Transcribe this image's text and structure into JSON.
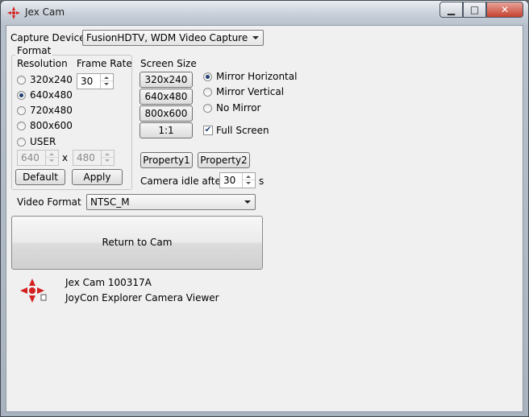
{
  "window": {
    "title": "Jex Cam",
    "controls": {
      "minimize": "▁",
      "maximize": "□",
      "close": "✕"
    }
  },
  "capture": {
    "label": "Capture Device",
    "device": "FusionHDTV, WDM Video Capture"
  },
  "format": {
    "group_title": "Format",
    "resolution_label": "Resolution",
    "frame_rate_label": "Frame Rate",
    "frame_rate_value": "30",
    "resolutions": [
      {
        "label": "320x240",
        "selected": false
      },
      {
        "label": "640x480",
        "selected": true
      },
      {
        "label": "720x480",
        "selected": false
      },
      {
        "label": "800x600",
        "selected": false
      },
      {
        "label": "USER",
        "selected": false
      }
    ],
    "user_width": "640",
    "user_sep": "x",
    "user_height": "480",
    "default_label": "Default",
    "apply_label": "Apply"
  },
  "screen": {
    "label": "Screen Size",
    "buttons": [
      "320x240",
      "640x480",
      "800x600",
      "1:1"
    ]
  },
  "mirror": {
    "options": [
      {
        "label": "Mirror Horizontal",
        "selected": true
      },
      {
        "label": "Mirror Vertical",
        "selected": false
      },
      {
        "label": "No Mirror",
        "selected": false
      }
    ],
    "full_screen_label": "Full Screen",
    "full_screen_checked": true
  },
  "properties": {
    "property1_label": "Property1",
    "property2_label": "Property2"
  },
  "idle": {
    "label": "Camera idle after",
    "value": "30",
    "unit": "s"
  },
  "video_format": {
    "label": "Video Format",
    "value": "NTSC_M"
  },
  "return_button": "Return to Cam",
  "about": {
    "version": "Jex Cam 100317A",
    "description": "JoyCon Explorer Camera Viewer"
  },
  "colors": {
    "accent_red": "#d42020",
    "selection": "#1f3f70"
  }
}
